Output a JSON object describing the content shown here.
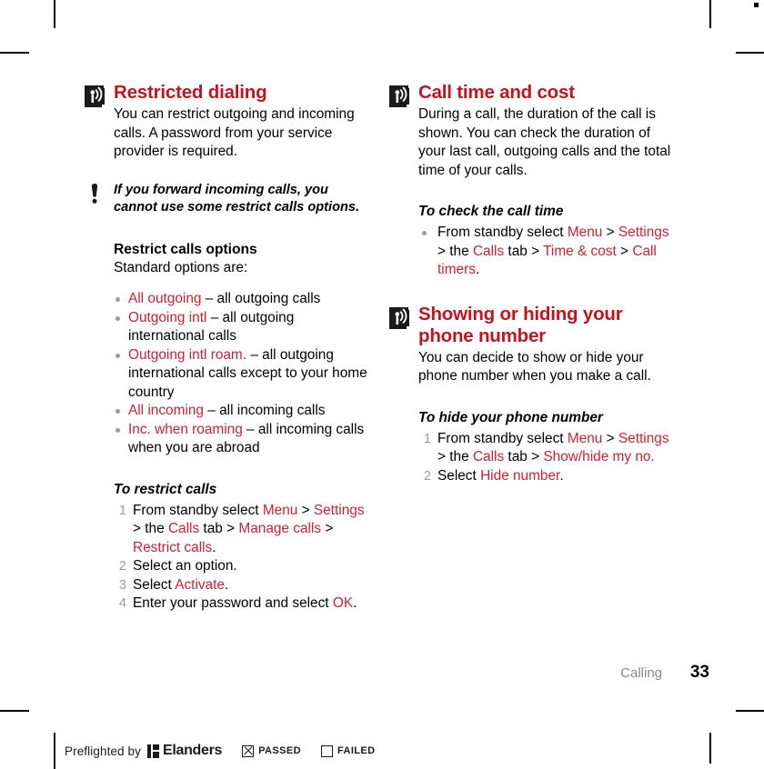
{
  "colors": {
    "heading_red": "#C4121F",
    "link_red": "#CF2032",
    "marker_gray": "#9b9b9b",
    "footer_gray": "#878787",
    "body_black": "#000000"
  },
  "left_column": {
    "section": {
      "icon": "radio-waves-icon",
      "title": "Restricted dialing",
      "body": "You can restrict outgoing and incoming calls. A password from your service provider is required."
    },
    "note": {
      "icon": "exclamation-icon",
      "text": "If you forward incoming calls, you cannot use some restrict calls options."
    },
    "options_heading": "Restrict calls options",
    "options_lead": "Standard options are:",
    "options": [
      {
        "term": "All outgoing",
        "desc": " – all outgoing calls"
      },
      {
        "term": "Outgoing intl",
        "desc": " – all outgoing international calls"
      },
      {
        "term": "Outgoing intl roam.",
        "desc": " – all outgoing international calls except to your home country"
      },
      {
        "term": "All incoming",
        "desc": " – all incoming calls"
      },
      {
        "term": "Inc. when roaming",
        "desc": " – all incoming calls when you are abroad"
      }
    ],
    "procedure_heading": "To restrict calls",
    "steps": [
      {
        "parts": [
          {
            "t": "From standby select ",
            "style": "plain"
          },
          {
            "t": "Menu",
            "style": "link"
          },
          {
            "t": " > ",
            "style": "plain"
          },
          {
            "t": "Settings",
            "style": "link"
          },
          {
            "t": " > the ",
            "style": "plain"
          },
          {
            "t": "Calls",
            "style": "link"
          },
          {
            "t": " tab > ",
            "style": "plain"
          },
          {
            "t": "Manage calls",
            "style": "link"
          },
          {
            "t": " > ",
            "style": "plain"
          },
          {
            "t": "Restrict calls",
            "style": "link"
          },
          {
            "t": ".",
            "style": "plain"
          }
        ]
      },
      {
        "parts": [
          {
            "t": "Select an option.",
            "style": "plain"
          }
        ]
      },
      {
        "parts": [
          {
            "t": "Select ",
            "style": "plain"
          },
          {
            "t": "Activate",
            "style": "link"
          },
          {
            "t": ".",
            "style": "plain"
          }
        ]
      },
      {
        "parts": [
          {
            "t": "Enter your password and select ",
            "style": "plain"
          },
          {
            "t": "OK",
            "style": "link"
          },
          {
            "t": ".",
            "style": "plain"
          }
        ]
      }
    ]
  },
  "right_column": {
    "section_one": {
      "icon": "radio-waves-icon",
      "title": "Call time and cost",
      "body": "During a call, the duration of the call is shown. You can check the duration of your last call, outgoing calls and the total time of your calls.",
      "procedure_heading": "To check the call time",
      "steps": [
        {
          "parts": [
            {
              "t": "From standby select ",
              "style": "plain"
            },
            {
              "t": "Menu",
              "style": "link"
            },
            {
              "t": " > ",
              "style": "plain"
            },
            {
              "t": "Settings",
              "style": "link"
            },
            {
              "t": " > the ",
              "style": "plain"
            },
            {
              "t": "Calls",
              "style": "link"
            },
            {
              "t": " tab > ",
              "style": "plain"
            },
            {
              "t": "Time & cost",
              "style": "link"
            },
            {
              "t": " > ",
              "style": "plain"
            },
            {
              "t": "Call timers",
              "style": "link"
            },
            {
              "t": ".",
              "style": "plain"
            }
          ]
        }
      ]
    },
    "section_two": {
      "icon": "radio-waves-icon",
      "title": "Showing or hiding your phone number",
      "body": "You can decide to show or hide your phone number when you make a call.",
      "procedure_heading": "To hide your phone number",
      "steps": [
        {
          "parts": [
            {
              "t": "From standby select ",
              "style": "plain"
            },
            {
              "t": "Menu",
              "style": "link"
            },
            {
              "t": " > ",
              "style": "plain"
            },
            {
              "t": "Settings",
              "style": "link"
            },
            {
              "t": " > the ",
              "style": "plain"
            },
            {
              "t": "Calls",
              "style": "link"
            },
            {
              "t": " tab > ",
              "style": "plain"
            },
            {
              "t": "Show/hide my no.",
              "style": "link"
            }
          ]
        },
        {
          "parts": [
            {
              "t": "Select ",
              "style": "plain"
            },
            {
              "t": "Hide number",
              "style": "link"
            },
            {
              "t": ".",
              "style": "plain"
            }
          ]
        }
      ]
    }
  },
  "footer": {
    "chapter": "Calling",
    "page_number": "33"
  },
  "preflight": {
    "prefix": "Preflighted by",
    "brand": "Elanders",
    "passed_label": "PASSED",
    "failed_label": "FAILED",
    "passed_checked": true,
    "failed_checked": false
  }
}
